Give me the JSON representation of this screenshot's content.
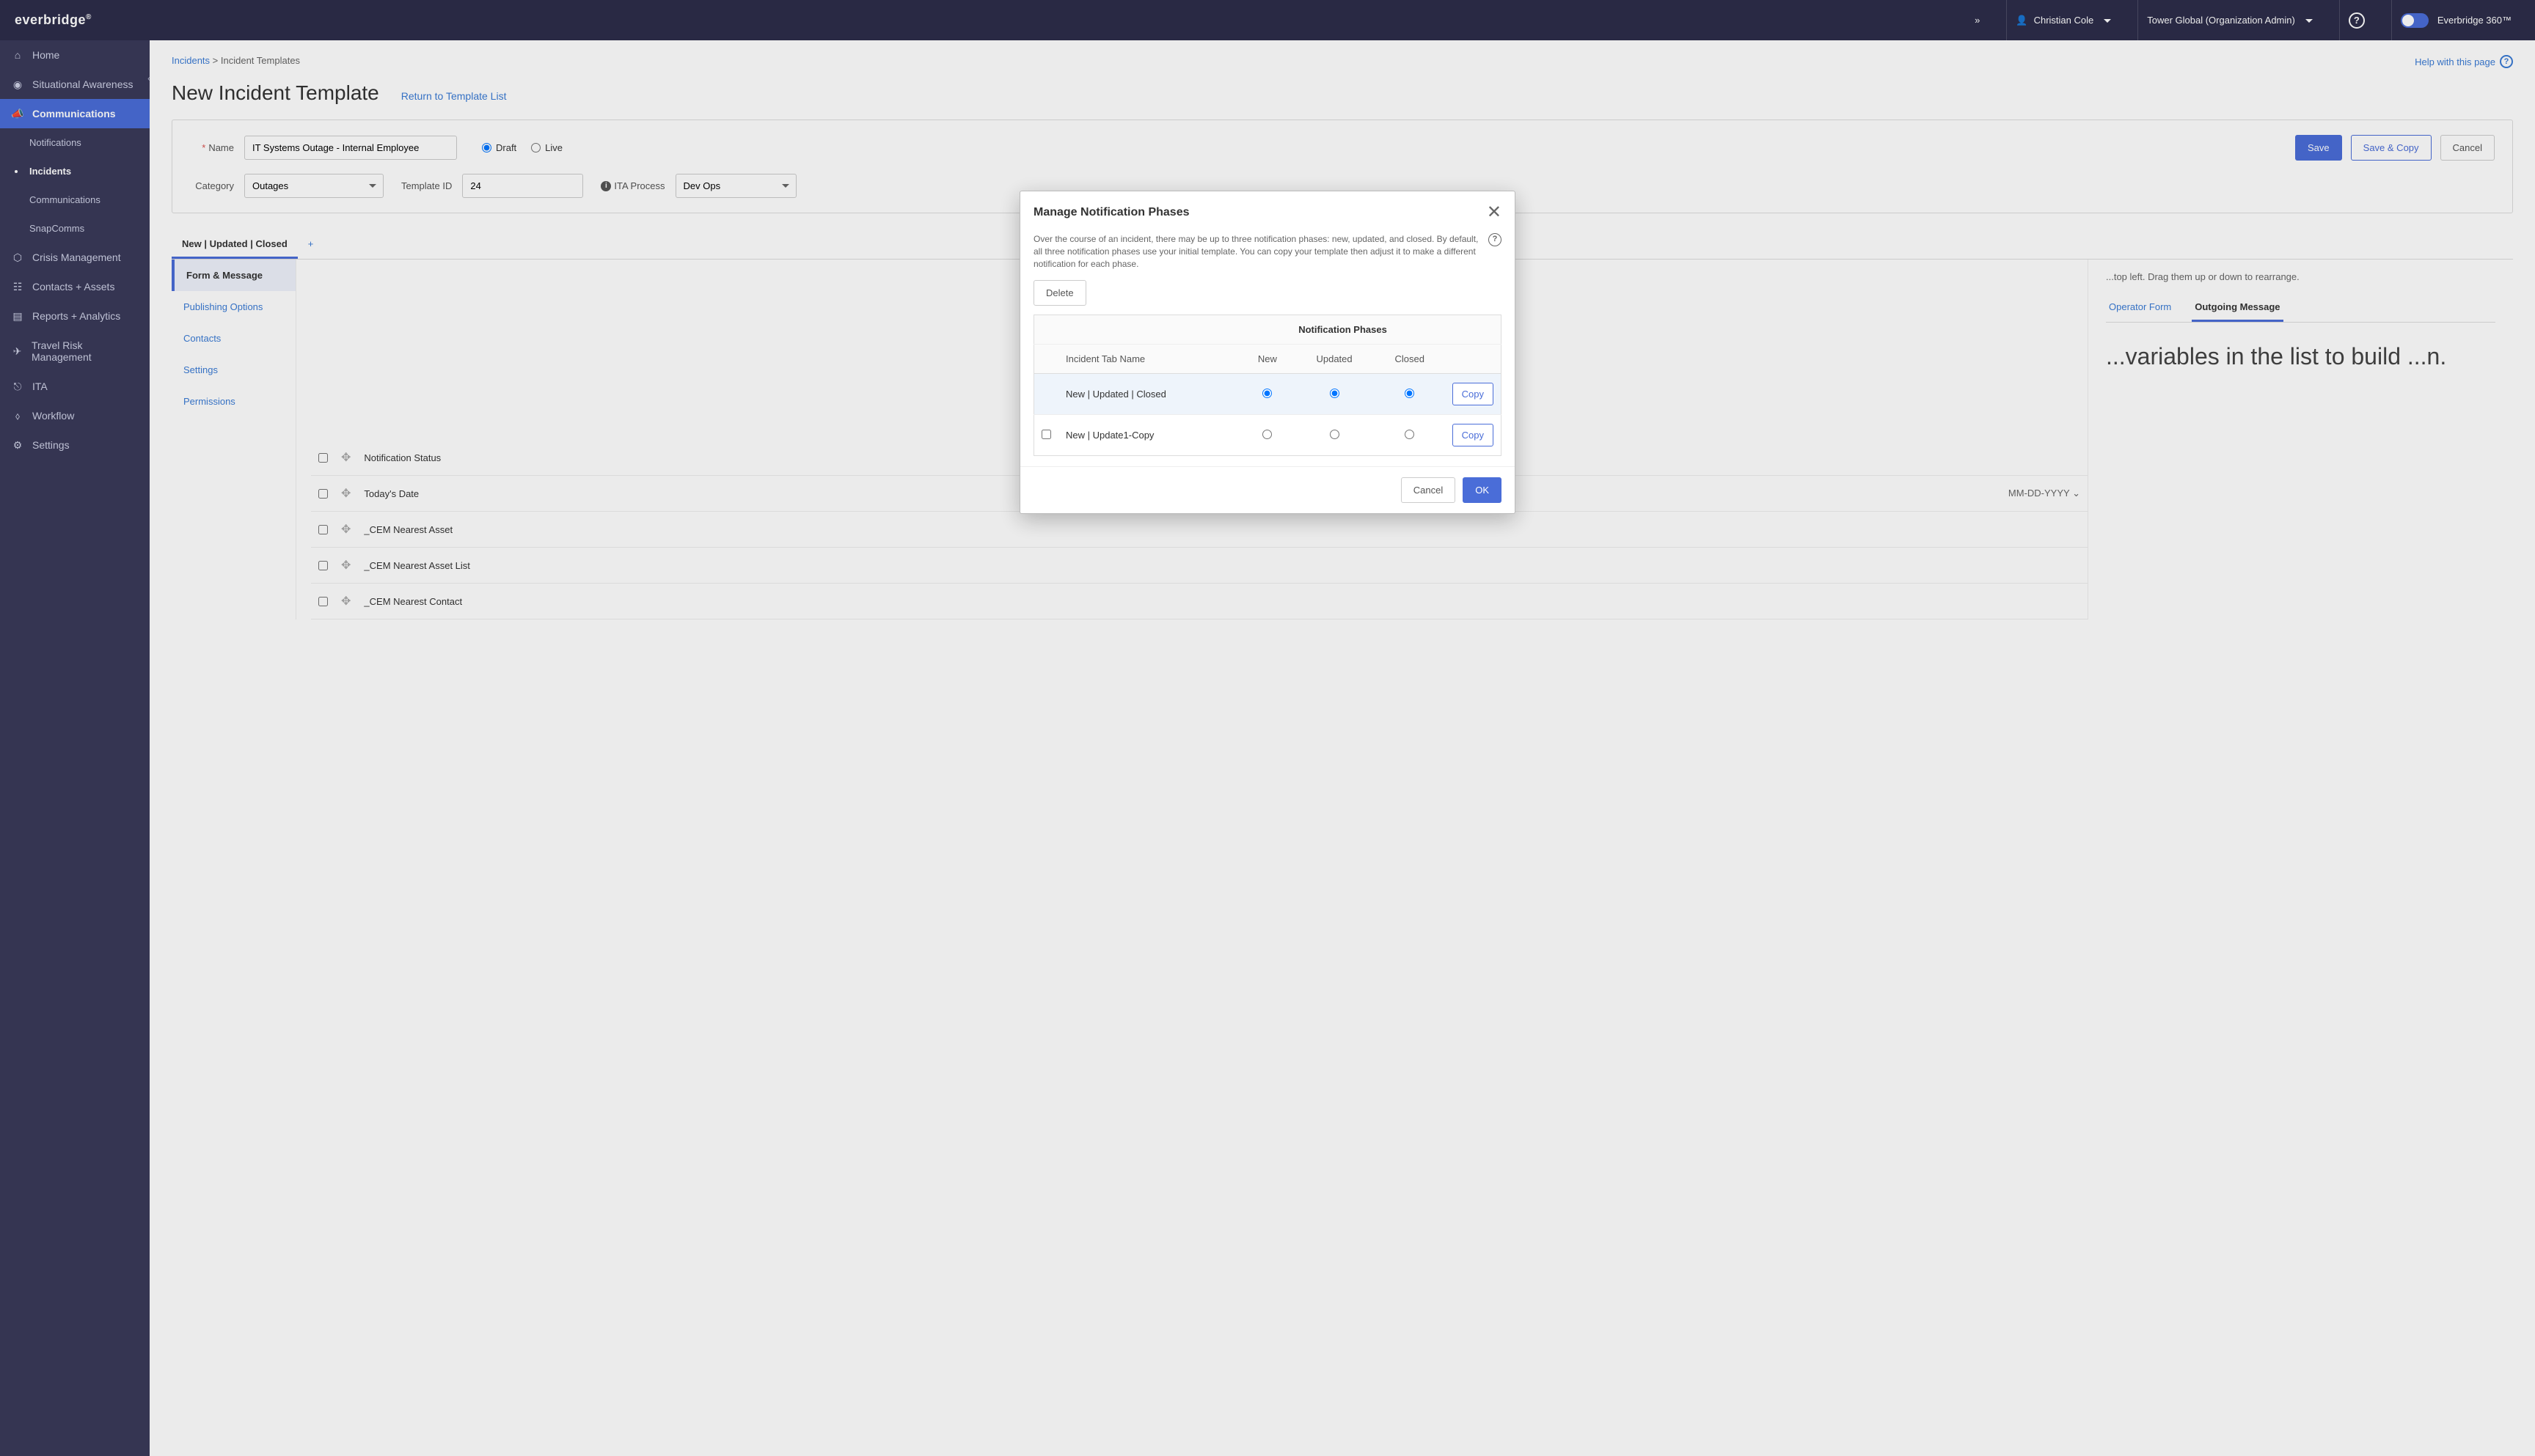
{
  "topbar": {
    "brand": "everbridge",
    "user": "Christian Cole",
    "org": "Tower Global (Organization Admin)",
    "product": "Everbridge 360™",
    "collapse_hint": "»"
  },
  "sidebar": {
    "items": [
      {
        "label": "Home",
        "icon": "home-icon"
      },
      {
        "label": "Situational Awareness",
        "icon": "globe-icon"
      },
      {
        "label": "Communications",
        "icon": "megaphone-icon",
        "active": true
      },
      {
        "label": "Notifications",
        "sub": true
      },
      {
        "label": "Incidents",
        "sub": true,
        "selected": true
      },
      {
        "label": "Communications",
        "sub": true
      },
      {
        "label": "SnapComms",
        "sub": true
      },
      {
        "label": "Crisis Management",
        "icon": "shield-icon"
      },
      {
        "label": "Contacts + Assets",
        "icon": "contacts-icon"
      },
      {
        "label": "Reports + Analytics",
        "icon": "reports-icon"
      },
      {
        "label": "Travel Risk Management",
        "icon": "travel-icon"
      },
      {
        "label": "ITA",
        "icon": "ita-icon"
      },
      {
        "label": "Workflow",
        "icon": "workflow-icon"
      },
      {
        "label": "Settings",
        "icon": "gear-icon"
      }
    ],
    "collapse_label": "«"
  },
  "breadcrumb": {
    "root": "Incidents",
    "sep": ">",
    "current": "Incident Templates",
    "help": "Help with this page"
  },
  "page": {
    "title": "New Incident Template",
    "return": "Return to Template List"
  },
  "form": {
    "name_label": "Name",
    "name_value": "IT Systems Outage - Internal Employee",
    "status_draft": "Draft",
    "status_live": "Live",
    "save": "Save",
    "save_copy": "Save & Copy",
    "cancel": "Cancel",
    "category_label": "Category",
    "category_value": "Outages",
    "template_id_label": "Template ID",
    "template_id_value": "24",
    "ita_label": "ITA Process",
    "ita_value": "Dev Ops"
  },
  "phase_tab": {
    "active": "New | Updated | Closed",
    "add": "+"
  },
  "side_tabs": {
    "items": [
      "Form & Message",
      "Publishing Options",
      "Contacts",
      "Settings",
      "Permissions"
    ]
  },
  "var_panel": {
    "hint": "...top left. Drag them up or down to rearrange.",
    "rows": [
      "Notification Status",
      "Today's Date",
      "_CEM Nearest Asset",
      "_CEM Nearest Asset List",
      "_CEM Nearest Contact"
    ],
    "date_fmt": "MM-DD-YYYY"
  },
  "preview": {
    "tabs": [
      "Operator Form",
      "Outgoing Message"
    ],
    "body": "...variables in the list to build ...n."
  },
  "modal": {
    "title": "Manage Notification Phases",
    "desc": "Over the course of an incident, there may be up to three notification phases: new, updated, and closed. By default, all three notification phases use your initial template.\nYou can copy your template then adjust it to make a different notification for each phase.",
    "delete": "Delete",
    "table_header": "Notification Phases",
    "col_tab": "Incident Tab Name",
    "col_new": "New",
    "col_updated": "Updated",
    "col_closed": "Closed",
    "rows": [
      {
        "name": "New | Updated | Closed",
        "copy": "Copy",
        "selected": true
      },
      {
        "name": "New | Update1-Copy",
        "copy": "Copy",
        "selected": false
      }
    ],
    "cancel": "Cancel",
    "ok": "OK"
  }
}
